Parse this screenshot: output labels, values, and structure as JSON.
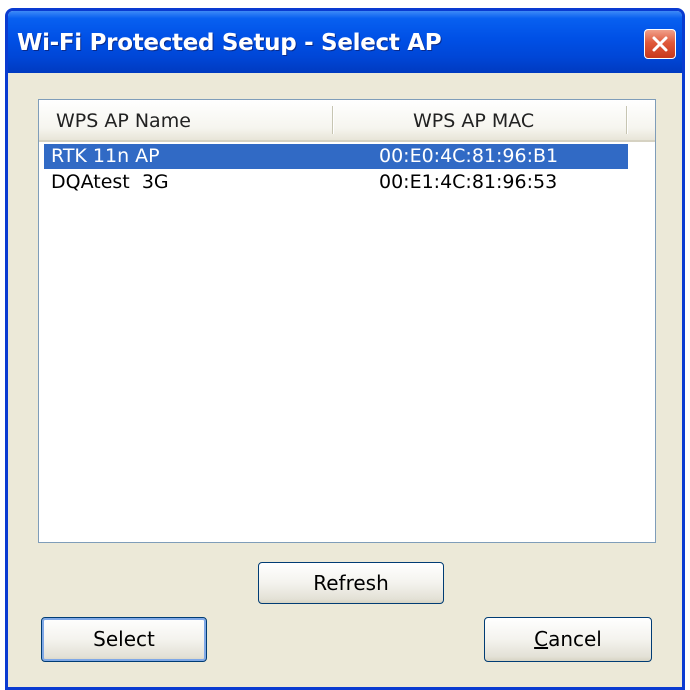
{
  "window": {
    "title": "Wi-Fi Protected Setup - Select AP"
  },
  "list": {
    "columns": [
      "WPS AP Name",
      "WPS AP MAC"
    ],
    "rows": [
      {
        "name": "RTK 11n AP",
        "mac": "00:E0:4C:81:96:B1",
        "selected": true
      },
      {
        "name": "DQAtest  3G",
        "mac": "00:E1:4C:81:96:53",
        "selected": false
      }
    ]
  },
  "buttons": {
    "refresh": "Refresh",
    "select": "Select",
    "cancel": "Cancel"
  },
  "colors": {
    "title_bar": "#0050e6",
    "selection": "#316ac5",
    "dialog_bg": "#ece9d8"
  },
  "icons": {
    "close": "close-icon"
  }
}
